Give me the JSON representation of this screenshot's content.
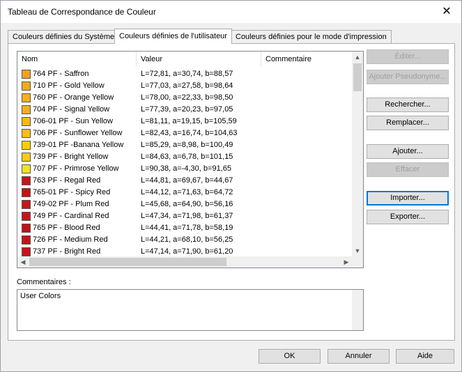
{
  "window": {
    "title": "Tableau de Correspondance de Couleur"
  },
  "tabs": [
    {
      "label": "Couleurs définies du Système",
      "active": false
    },
    {
      "label": "Couleurs définies de l'utilisateur",
      "active": true
    },
    {
      "label": "Couleurs définies pour le mode d'impression",
      "active": false
    }
  ],
  "list": {
    "columns": [
      "Nom",
      "Valeur",
      "Commentaire"
    ],
    "rows": [
      {
        "name": "764 PF - Saffron",
        "value": "L=72,81, a=30,74, b=88,57",
        "color": "#f2a024"
      },
      {
        "name": "710 PF - Gold Yellow",
        "value": "L=77,03, a=27,58, b=98,64",
        "color": "#f5a91a"
      },
      {
        "name": "760 PF - Orange Yellow",
        "value": "L=78,00, a=22,33, b=98,50",
        "color": "#f6ae1c"
      },
      {
        "name": "704 PF - Signal Yellow",
        "value": "L=77,39, a=20,23, b=97,05",
        "color": "#f3b01e"
      },
      {
        "name": "706-01 PF - Sun Yellow",
        "value": "L=81,11, a=19,15, b=105,59",
        "color": "#fbb812"
      },
      {
        "name": "706 PF - Sunflower Yellow",
        "value": "L=82,43, a=16,74, b=104,63",
        "color": "#fcbd14"
      },
      {
        "name": "739-01 PF -Banana Yellow",
        "value": "L=85,29, a=8,98, b=100,49",
        "color": "#fdcb10"
      },
      {
        "name": "739 PF - Bright Yellow",
        "value": "L=84,63, a=6,78, b=101,15",
        "color": "#f8cb16"
      },
      {
        "name": "707 PF - Primrose Yellow",
        "value": "L=90,38, a=-4,30, b=91,65",
        "color": "#f6e21c"
      },
      {
        "name": "763 PF - Regal Red",
        "value": "L=44,81, a=69,67, b=44,67",
        "color": "#c4161c"
      },
      {
        "name": "765-01 PF - Spicy Red",
        "value": "L=44,12, a=71,63, b=64,72",
        "color": "#c41410"
      },
      {
        "name": "749-02 PF - Plum Red",
        "value": "L=45,68, a=64,90, b=56,16",
        "color": "#c21a18"
      },
      {
        "name": "749 PF - Cardinal Red",
        "value": "L=47,34, a=71,98, b=61,37",
        "color": "#c8141a"
      },
      {
        "name": "765 PF - Blood Red",
        "value": "L=44,41, a=71,78, b=58,19",
        "color": "#c01218"
      },
      {
        "name": "726 PF - Medium Red",
        "value": "L=44,21, a=68,10, b=56,25",
        "color": "#bf1818"
      },
      {
        "name": "737 PF - Bright Red",
        "value": "L=47,14, a=71,90, b=61,20",
        "color": "#c8141a"
      }
    ]
  },
  "side_buttons": {
    "edit": "Éditer...",
    "add_alias": "Ajouter Pseudonyme...",
    "search": "Rechercher...",
    "replace": "Remplacer...",
    "add": "Ajouter...",
    "delete": "Effacer",
    "import": "Importer...",
    "export": "Exporter..."
  },
  "comments": {
    "label": "Commentaires :",
    "text": "User Colors"
  },
  "footer": {
    "ok": "OK",
    "cancel": "Annuler",
    "help": "Aide"
  },
  "icons": {
    "close": "close-icon",
    "up": "arrow-up-icon",
    "down": "arrow-down-icon",
    "left": "arrow-left-icon",
    "right": "arrow-right-icon"
  }
}
